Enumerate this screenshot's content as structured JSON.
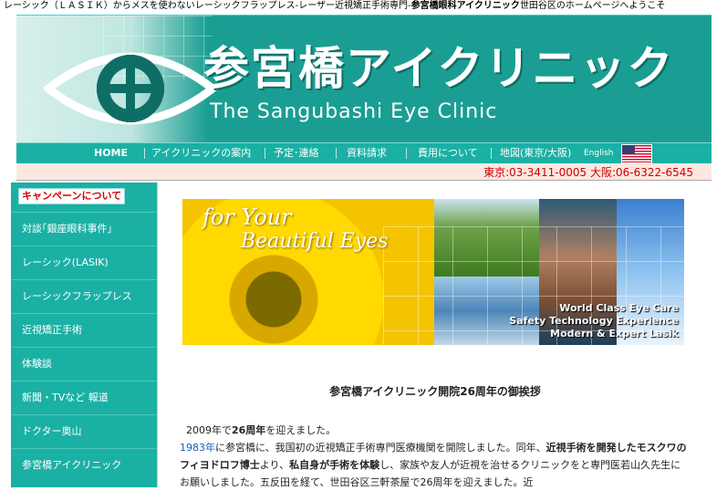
{
  "top_notice": {
    "text_before": "レーシック（ＬＡＳＩＫ）からメスを使わないレーシックフラップレス-レーザー近視矯正手術専門-",
    "bold": "参宮橋眼科アイクリニック",
    "text_after": "世田谷区のホームページへようこそ"
  },
  "banner": {
    "title_jp": "参宮橋アイクリニック",
    "title_en": "The Sangubashi Eye Clinic"
  },
  "nav": {
    "items": [
      "HOME",
      "アイクリニックの案内",
      "予定･連絡",
      "資料請求",
      "費用について",
      "地図(東京/大阪)"
    ],
    "english": "English"
  },
  "phone": "東京:03-3411-0005  大阪:06-6322-6545",
  "sidebar": {
    "campaign": "キャンペーンについて",
    "items": [
      "対談｢銀座眼科事件｣",
      "レーシック(LASIK)",
      "レーシックフラップレス",
      "近視矯正手術",
      "体験談",
      "新聞・TVなど 報道",
      "ドクター奥山",
      "参宮橋アイクリニック"
    ]
  },
  "hero": {
    "line1": "for Your",
    "line2": "Beautiful Eyes",
    "slogan1": "World Class Eye Care",
    "slogan2": "Safety Technology Experience",
    "slogan3": "Modern & Expert Lasik"
  },
  "greeting": {
    "title": "参宮橋アイクリニック開院26周年の御挨拶",
    "p1_a": "2009年で",
    "p1_b": "26周年",
    "p1_c": "を迎えました。",
    "p2_year": "1983年",
    "p2_a": "に参宮橋に、我国初の近視矯正手術専門医療機関を開院しました。同年、",
    "p2_b": "近視手術を開発したモスクワのフィヨドロフ博士",
    "p2_c": "より、",
    "p2_d": "私自身が手術を体験",
    "p2_e": "し、家族や友人が近視を治せるクリニックをと専門医若山久先生にお願いしました。五反田を経て、世田谷区三軒茶屋で26周年を迎えました。近"
  }
}
